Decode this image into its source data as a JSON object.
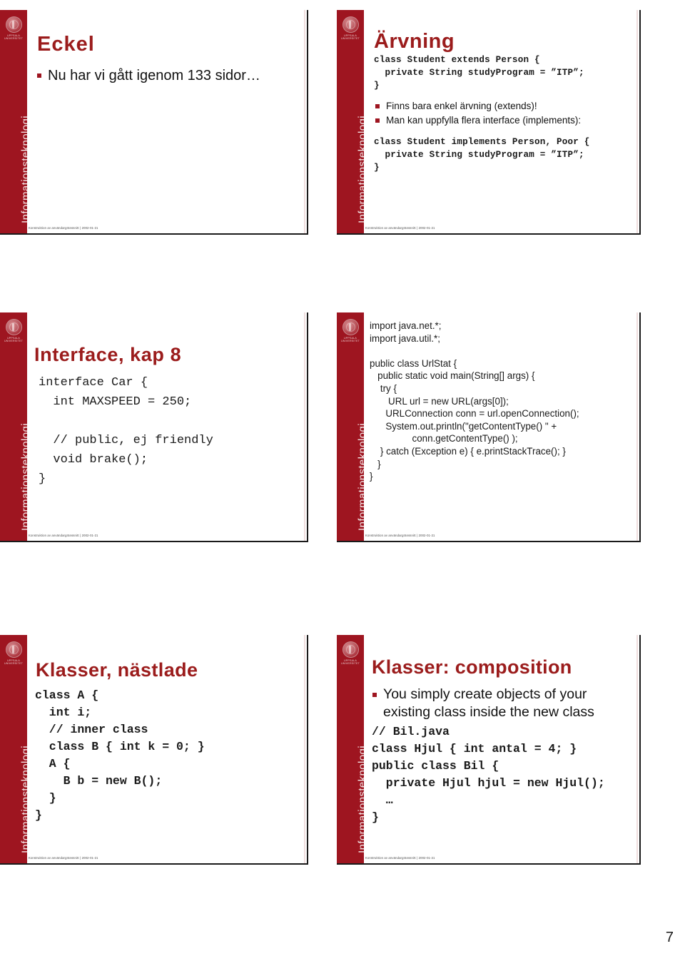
{
  "colors": {
    "sidebar_red": "#9e1520",
    "title_red": "#9b1c1c",
    "bullet_red": "#9e1520",
    "text_black": "#1a1a1a",
    "page_background": "#ffffff"
  },
  "sidebar": {
    "vertical_label": "Informationsteknologi",
    "logo_caption_line1": "UPPSALA",
    "logo_caption_line2": "UNIVERSITET"
  },
  "footer_text": "Konstruktion av användargränssnitt |  2002-01-21",
  "page_number": "7",
  "slides": [
    {
      "id": "slide-1",
      "title": "Eckel",
      "bullets": [
        "Nu har vi gått igenom 133 sidor…"
      ],
      "code": "",
      "code2": ""
    },
    {
      "id": "slide-2",
      "title": "Ärvning",
      "code": "class Student extends Person {\n  private String studyProgram = ”ITP”;\n}",
      "bullets": [
        "Finns bara enkel ärvning (extends)!",
        "Man kan uppfylla flera interface (implements):"
      ],
      "code2": "class Student implements Person, Poor {\n  private String studyProgram = ”ITP”;\n}"
    },
    {
      "id": "slide-3",
      "title": "Interface, kap 8",
      "code": "interface Car {\n  int MAXSPEED = 250;\n\n  // public, ej friendly\n  void brake();\n}",
      "bullets": [],
      "code2": ""
    },
    {
      "id": "slide-4",
      "title": "",
      "code": "import java.net.*;\nimport java.util.*;\n\npublic class UrlStat {\n   public static void main(String[] args) {\n    try {\n       URL url = new URL(args[0]);\n      URLConnection conn = url.openConnection();\n      System.out.println(\"getContentType() \" +\n                conn.getContentType() );\n    } catch (Exception e) { e.printStackTrace(); }\n   }\n}",
      "bullets": [],
      "code2": ""
    },
    {
      "id": "slide-5",
      "title": "Klasser, nästlade",
      "code": "class A {\n  int i;\n  // inner class\n  class B { int k = 0; }\n  A {\n    B b = new B();\n  }\n}",
      "bullets": [],
      "code2": ""
    },
    {
      "id": "slide-6",
      "title": "Klasser: composition",
      "bullets": [
        "You simply create objects of your existing class inside the new class"
      ],
      "code": "// Bil.java\nclass Hjul { int antal = 4; }\npublic class Bil {\n  private Hjul hjul = new Hjul();\n  …\n}",
      "code2": ""
    }
  ]
}
